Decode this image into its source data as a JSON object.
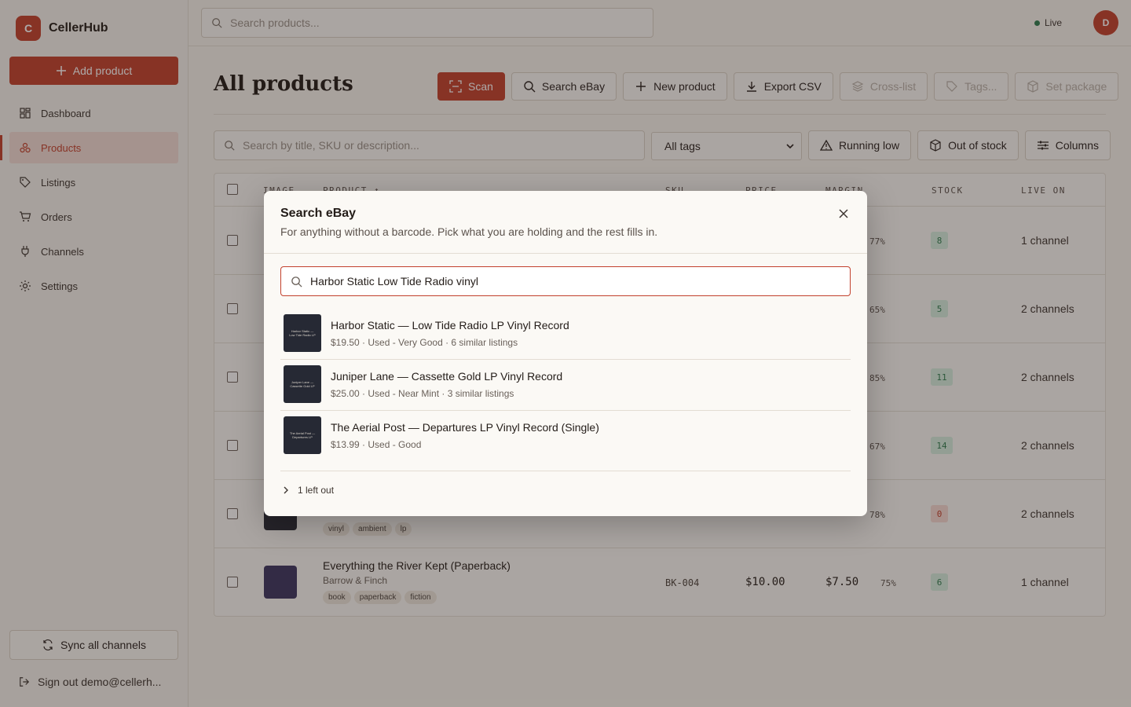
{
  "brand": {
    "logo_letter": "C",
    "name": "CellerHub"
  },
  "sidebar": {
    "add_label": "Add product",
    "items": [
      {
        "label": "Dashboard",
        "icon": "dashboard-icon",
        "active": false
      },
      {
        "label": "Products",
        "icon": "products-icon",
        "active": true
      },
      {
        "label": "Listings",
        "icon": "tag-icon",
        "active": false
      },
      {
        "label": "Orders",
        "icon": "cart-icon",
        "active": false
      },
      {
        "label": "Channels",
        "icon": "plug-icon",
        "active": false
      },
      {
        "label": "Settings",
        "icon": "gear-icon",
        "active": false
      }
    ],
    "sync_label": "Sync all channels",
    "signout_label": "Sign out demo@cellerh..."
  },
  "topbar": {
    "search_placeholder": "Search products...",
    "status": "Live",
    "avatar_letter": "D"
  },
  "main": {
    "title": "All products",
    "toolbar": {
      "scan": "Scan",
      "search_ebay": "Search eBay",
      "new_product": "New product",
      "export_csv": "Export CSV",
      "cross_list": "Cross-list",
      "tags": "Tags...",
      "set_package": "Set package"
    },
    "filters": {
      "search_placeholder": "Search by title, SKU or description...",
      "tag_select": "All tags",
      "running_low": "Running low",
      "out_of_stock": "Out of stock",
      "columns": "Columns"
    },
    "table": {
      "headers": {
        "image": "IMAGE",
        "product": "PRODUCT ↑",
        "sku": "SKU",
        "price": "PRICE",
        "margin": "MARGIN",
        "stock": "STOCK",
        "live_on": "LIVE ON"
      },
      "rows": [
        {
          "margin_pct": "77%",
          "stock": "8",
          "live_on": "1 channel"
        },
        {
          "margin_pct": "65%",
          "stock": "5",
          "live_on": "2 channels"
        },
        {
          "margin_pct": "85%",
          "stock": "11",
          "live_on": "2 channels"
        },
        {
          "margin_pct": "67%",
          "stock": "14",
          "live_on": "2 channels"
        },
        {
          "tags": [
            "vinyl",
            "ambient",
            "lp"
          ],
          "margin_pct": "78%",
          "stock": "0",
          "live_on": "2 channels"
        },
        {
          "title": "Everything the River Kept (Paperback)",
          "subtitle": "Barrow & Finch",
          "tags": [
            "book",
            "paperback",
            "fiction"
          ],
          "sku": "BK-004",
          "price": "$10.00",
          "margin": "$7.50",
          "margin_pct": "75%",
          "stock": "6",
          "live_on": "1 channel"
        }
      ]
    }
  },
  "modal": {
    "title": "Search eBay",
    "description": "For anything without a barcode. Pick what you are holding and the rest fills in.",
    "query": "Harbor Static Low Tide Radio vinyl",
    "results": [
      {
        "title": "Harbor Static — Low Tide Radio LP Vinyl Record",
        "meta": "$19.50 · Used - Very Good · 6 similar listings",
        "thumb_text": "Harbor Static — Low Tide Radio LP"
      },
      {
        "title": "Juniper Lane — Cassette Gold LP Vinyl Record",
        "meta": "$25.00 · Used - Near Mint · 3 similar listings",
        "thumb_text": "Juniper Lane — Cassette Gold LP"
      },
      {
        "title": "The Aerial Post — Departures LP Vinyl Record (Single)",
        "meta": "$13.99 · Used - Good",
        "thumb_text": "The Aerial Post — Departures LP"
      }
    ],
    "left_out": "1 left out"
  },
  "colors": {
    "accent": "#c2412d",
    "success": "#2f7d4f",
    "background": "#f7f4ee"
  }
}
